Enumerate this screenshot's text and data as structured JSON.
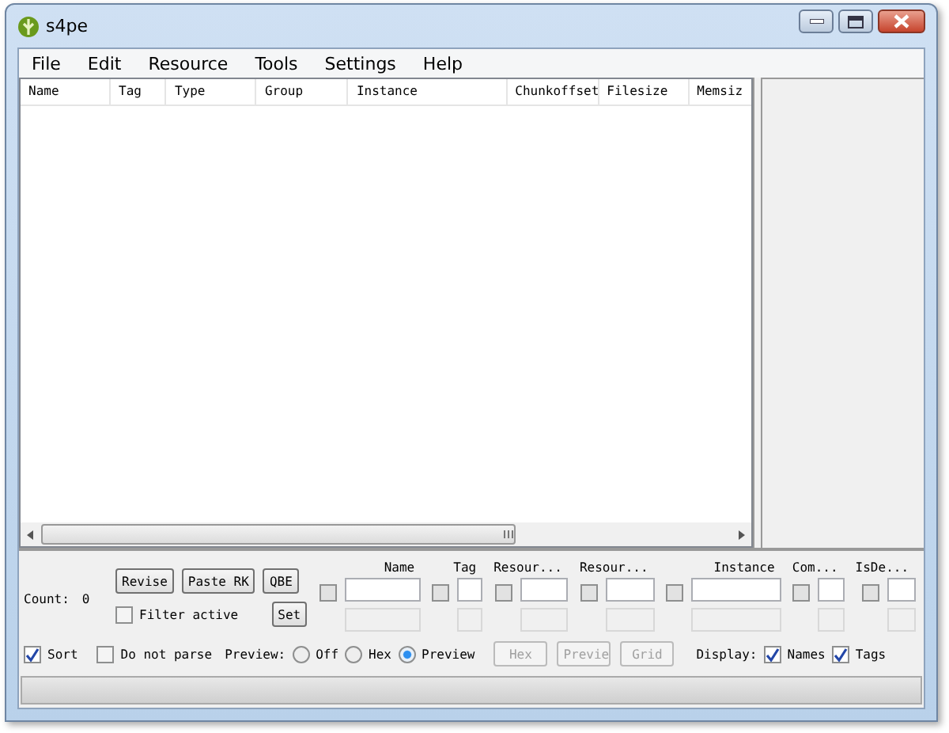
{
  "window": {
    "title": "s4pe"
  },
  "menu": [
    "File",
    "Edit",
    "Resource",
    "Tools",
    "Settings",
    "Help"
  ],
  "table": {
    "columns": [
      "Name",
      "Tag",
      "Type",
      "Group",
      "Instance",
      "Chunkoffset",
      "Filesize",
      "Memsiz"
    ]
  },
  "filter": {
    "count_label": "Count:",
    "count": "0",
    "buttons": [
      {
        "label": "Revise",
        "disabled": false
      },
      {
        "label": "Paste RK",
        "disabled": false
      },
      {
        "label": "QBE",
        "disabled": false
      },
      {
        "label": "Set",
        "disabled": false
      }
    ],
    "filter_active": {
      "label": "Filter active",
      "checked": false
    },
    "columns": [
      {
        "label": "Name",
        "checked": false
      },
      {
        "label": "Tag",
        "checked": false
      },
      {
        "label": "Resour...",
        "checked": false
      },
      {
        "label": "Resour...",
        "checked": false
      },
      {
        "label": "Instance",
        "checked": false
      },
      {
        "label": "Com...",
        "checked": false
      },
      {
        "label": "IsDe...",
        "checked": false
      }
    ]
  },
  "options": {
    "sort": {
      "label": "Sort",
      "checked": true
    },
    "do_not_parse": {
      "label": "Do not parse",
      "checked": false
    },
    "preview_label": "Preview:",
    "preview_modes": [
      {
        "label": "Off",
        "selected": false
      },
      {
        "label": "Hex",
        "selected": false
      },
      {
        "label": "Preview",
        "selected": true
      }
    ],
    "actions": [
      {
        "label": "Hex",
        "disabled": true
      },
      {
        "label": "Previe",
        "disabled": true
      },
      {
        "label": "Grid",
        "disabled": true
      }
    ],
    "display_label": "Display:",
    "display": [
      {
        "label": "Names",
        "checked": true
      },
      {
        "label": "Tags",
        "checked": true
      }
    ]
  }
}
